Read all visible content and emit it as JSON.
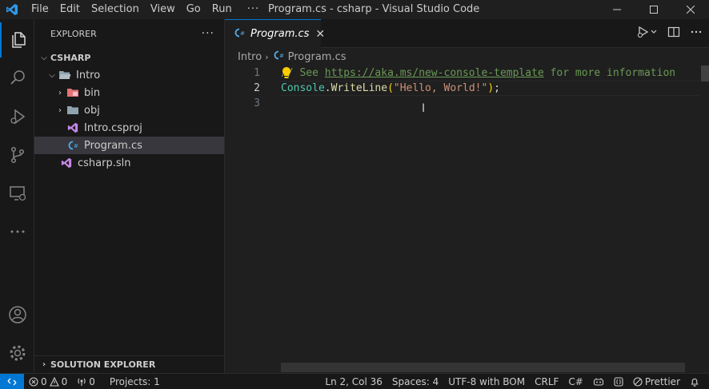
{
  "menu": [
    "File",
    "Edit",
    "Selection",
    "View",
    "Go",
    "Run"
  ],
  "menu_more": "···",
  "window_title": "Program.cs - csharp - Visual Studio Code",
  "explorer": {
    "title": "EXPLORER",
    "more": "···",
    "root": "CSHARP",
    "items": [
      {
        "label": "Intro"
      },
      {
        "label": "bin"
      },
      {
        "label": "obj"
      },
      {
        "label": "Intro.csproj"
      },
      {
        "label": "Program.cs"
      },
      {
        "label": "csharp.sln"
      }
    ],
    "solution_explorer": "SOLUTION EXPLORER"
  },
  "tab": {
    "label": "Program.cs",
    "close": "✕"
  },
  "breadcrumb": {
    "folder": "Intro",
    "sep": "›",
    "file": "Program.cs"
  },
  "code": {
    "line_numbers": [
      "1",
      "2",
      "3"
    ],
    "comment_prefix": "// See ",
    "comment_url": "https://aka.ms/new-console-template",
    "comment_suffix": " for more information",
    "class": "Console",
    "dot": ".",
    "method": "WriteLine",
    "open": "(",
    "string": "\"Hello, World!\"",
    "close": ")",
    "semi": ";"
  },
  "status": {
    "errors": "0",
    "warnings": "0",
    "ports": "0",
    "projects": "Projects: 1",
    "position": "Ln 2, Col 36",
    "spaces": "Spaces: 4",
    "encoding": "UTF-8 with BOM",
    "eol": "CRLF",
    "language": "C#",
    "prettier": "Prettier"
  },
  "colors": {
    "accent": "#0078d4",
    "csharp": "#4fa9e6",
    "vs_purple": "#c586e8"
  }
}
